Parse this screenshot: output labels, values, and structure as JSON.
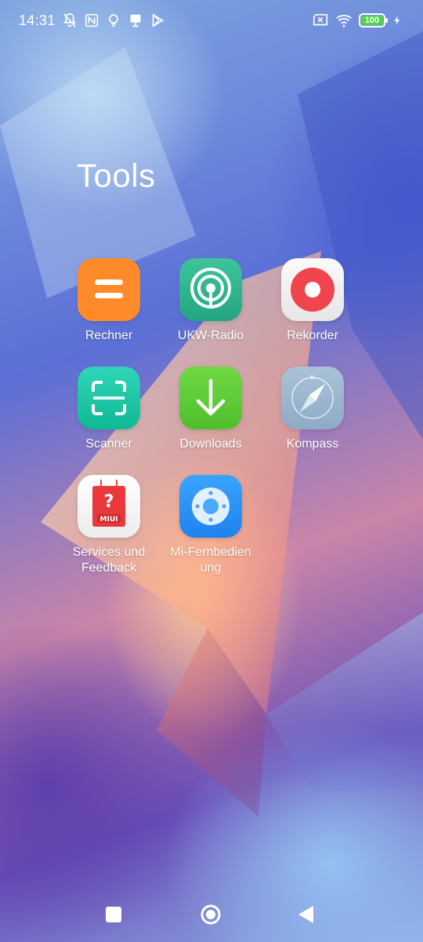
{
  "status_bar": {
    "time": "14:31",
    "battery_level": "100",
    "left_icons": [
      "notifications-off-icon",
      "nfc-icon",
      "bulb-icon",
      "monitor-icon",
      "play-store-icon"
    ],
    "right_icons": [
      "sim-off-icon",
      "wifi-icon",
      "battery-icon",
      "charging-icon"
    ]
  },
  "folder": {
    "title": "Tools",
    "apps": [
      {
        "id": "rechner",
        "label": "Rechner",
        "icon": "calculator-icon",
        "color": "#ff8a2a"
      },
      {
        "id": "ukw-radio",
        "label": "UKW-Radio",
        "icon": "radio-icon",
        "color": "#2fb88f"
      },
      {
        "id": "rekorder",
        "label": "Rekorder",
        "icon": "recorder-icon",
        "color": "#f25a5a"
      },
      {
        "id": "scanner",
        "label": "Scanner",
        "icon": "scanner-icon",
        "color": "#1cc9a6"
      },
      {
        "id": "downloads",
        "label": "Downloads",
        "icon": "download-icon",
        "color": "#5fcf3a"
      },
      {
        "id": "kompass",
        "label": "Kompass",
        "icon": "compass-icon",
        "color": "#9bb8d1"
      },
      {
        "id": "services",
        "label": "Services und Feedback",
        "icon": "help-feedback-icon",
        "color": "#e93b3b",
        "icon_text": "MIUI"
      },
      {
        "id": "mi-remote",
        "label": "Mi-Fernbedien ung",
        "icon": "remote-control-icon",
        "color": "#2e8ff5"
      }
    ]
  },
  "nav_bar": {
    "buttons": [
      "recents-button",
      "home-button",
      "back-button"
    ]
  }
}
